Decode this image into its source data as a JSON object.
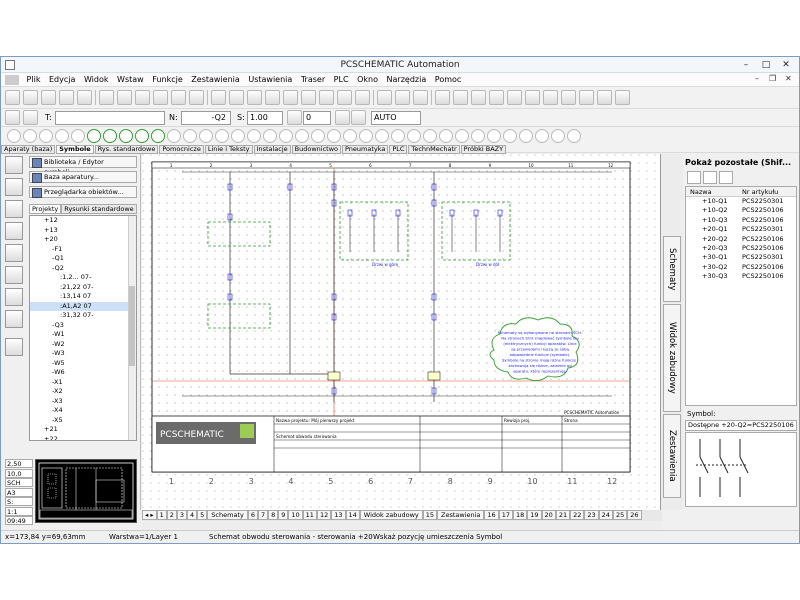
{
  "window": {
    "title": "PCSCHEMATIC Automation"
  },
  "menu": [
    "Plik",
    "Edycja",
    "Widok",
    "Wstaw",
    "Funkcje",
    "Zestawienia",
    "Ustawienia",
    "Traser",
    "PLC",
    "Okno",
    "Narzędzia",
    "Pomoc"
  ],
  "toolbar2": {
    "t_label": "T:",
    "t_value": "",
    "n_label": "N:",
    "n_value": "-Q2",
    "s_label": "S:",
    "s_value": "1.00",
    "angle_value": "0",
    "mode_value": "AUTO"
  },
  "symbol_tabs": [
    "Aparaty (baza)",
    "Symbole",
    "Rys. standardowe",
    "Pomocnicze",
    "Linie i Teksty",
    "Instalacje",
    "Budownictwo",
    "Pneumatyka",
    "PLC",
    "TechnMechatr",
    "Próbki BAZY"
  ],
  "symbol_tab_active": 1,
  "left": {
    "buttons": [
      "Biblioteka / Edytor symboli...",
      "Baza aparatury...",
      "Przeglądarka obiektów..."
    ],
    "tabs": [
      "Projekty",
      "Rysunki standardowe"
    ],
    "tree": [
      "+12",
      "+13",
      "+20",
      "-F1",
      "-Q1",
      "-Q2",
      ":1,2... 07-",
      ":21,22 07-",
      ":13,14 07",
      ":A1,A2 07",
      ":31,32 07-",
      "-Q3",
      "-W1",
      "-W2",
      "-W3",
      "-W5",
      "-W6",
      "-X1",
      "-X2",
      "-X3",
      "-X4",
      "-X5",
      "+21",
      "+22"
    ],
    "tree_selected": 9,
    "status_values": [
      "2,50",
      "10,0",
      "SCH",
      "A3",
      "S:",
      "1:1",
      "09:49"
    ]
  },
  "vertical_tabs": [
    "Schematy",
    "Widok zabudowy",
    "Zestawienia"
  ],
  "right": {
    "title": "Pokaż pozostałe (Shif...",
    "columns": [
      "Nazwa",
      "Nr artykułu"
    ],
    "rows": [
      {
        "name": "+10-Q1",
        "article": "PCS2250301"
      },
      {
        "name": "+10-Q2",
        "article": "PCS2250106"
      },
      {
        "name": "+10-Q3",
        "article": "PCS2250106"
      },
      {
        "name": "+20-Q1",
        "article": "PCS2250301"
      },
      {
        "name": "+20-Q2",
        "article": "PCS2250106"
      },
      {
        "name": "+20-Q3",
        "article": "PCS2250106"
      },
      {
        "name": "+30-Q1",
        "article": "PCS2250301"
      },
      {
        "name": "+30-Q2",
        "article": "PCS2250106"
      },
      {
        "name": "+30-Q3",
        "article": "PCS2250106"
      }
    ],
    "symbol_label": "Symbol:",
    "symbol_value": "Dostępne +20-Q2=PCS2250106"
  },
  "schematic": {
    "column_numbers": [
      "1",
      "2",
      "3",
      "4",
      "5",
      "6",
      "7",
      "8",
      "9",
      "10",
      "11",
      "12"
    ],
    "logo": "PCSCHEMATIC",
    "cloud_text": [
      "Schematy są wykonywane na stronach SCH.",
      "Na stronach SCH znajdować symbole dla",
      "(elektrycznych) funkcji aparatów. Linie",
      "są przewodami i łączą ze sobą",
      "odpowiednie funkcje (symbole).",
      "Symbole na stronie mają różne funkcje i",
      "zachowują się różnie, zależnie od",
      "aparatu, który reprezentują."
    ],
    "label_left": "Drzwi w górę",
    "label_right": "Drzwi w dół",
    "title_block": {
      "project": "Nazwa projektu: Mój pierwszy projekt",
      "drawing": "Schemat obwodu sterowania",
      "page_info": "Strona",
      "revision": "Rewizja proj.",
      "company": "PCSCHEMATIC Automation"
    }
  },
  "page_tabs": [
    "1",
    "2",
    "3",
    "4",
    "5",
    "Schematy",
    "6",
    "7",
    "8",
    "9",
    "10",
    "11",
    "12",
    "13",
    "14",
    "Widok zabudowy",
    "15",
    "Zestawienia",
    "16",
    "17",
    "18",
    "19",
    "20",
    "21",
    "22",
    "23",
    "24",
    "25",
    "26"
  ],
  "status": {
    "coords": "x=173,84 y=69,63mm",
    "layer": "Warstwa=1/Layer 1",
    "page": "Schemat obwodu sterowania - sterowania +20",
    "hint": "Wskaż pozycję umieszczenia Symbol"
  },
  "colors": {
    "grid_border": "#000000",
    "wire": "#333333",
    "blue_text": "#1a1aff",
    "green_dashed": "#2e9f2e",
    "cloud": "#2e9f2e",
    "red_line": "#e05020"
  }
}
